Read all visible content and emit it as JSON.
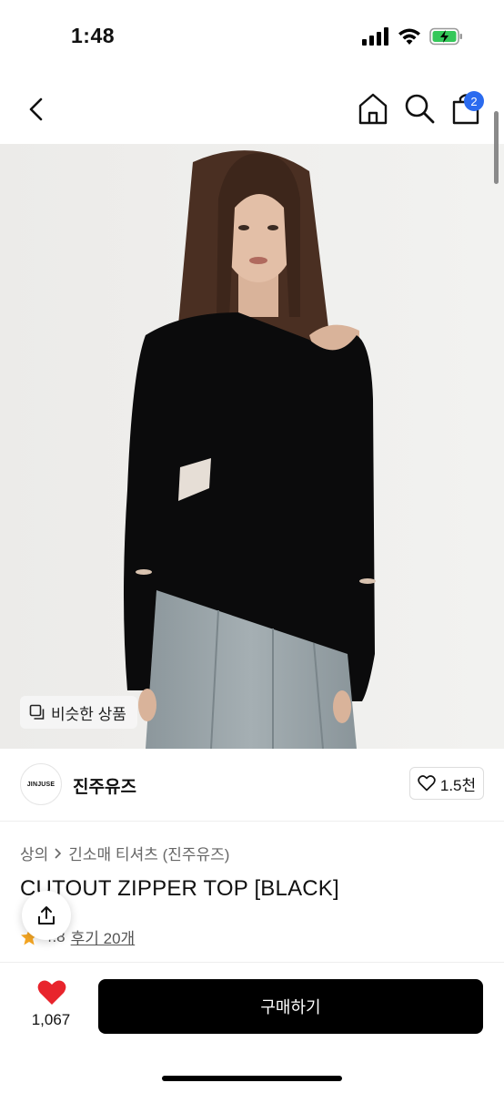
{
  "status_bar": {
    "time": "1:48",
    "icons": [
      "signal-icon",
      "wifi-icon",
      "battery-charging-icon"
    ],
    "battery_color": "#34c759"
  },
  "nav": {
    "icons": [
      "back-chevron-icon",
      "home-icon",
      "search-icon",
      "cart-icon"
    ],
    "cart_badge": "2",
    "badge_color": "#2b6bef"
  },
  "hero": {
    "similar_button_label": "비슷한 상품"
  },
  "brand": {
    "logo_text": "JINJUSE",
    "name": "진주유즈",
    "like_count": "1.5천"
  },
  "product": {
    "breadcrumb": [
      "상의",
      "긴소매 티셔츠 (진주유즈)"
    ],
    "title": "CUTOUT ZIPPER TOP [BLACK]",
    "rating": "4.8",
    "reviews": "후기 20개"
  },
  "bottom": {
    "wish_count": "1,067",
    "buy_label": "구매하기",
    "heart_color": "#e8242c"
  }
}
